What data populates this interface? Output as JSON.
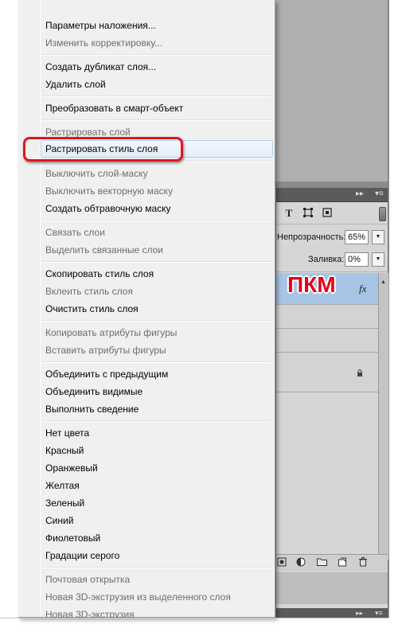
{
  "context_menu": {
    "items": [
      {
        "label": "Параметры наложения...",
        "enabled": true
      },
      {
        "label": "Изменить корректировку...",
        "enabled": false
      },
      {
        "label": "Создать дубликат слоя...",
        "enabled": true
      },
      {
        "label": "Удалить слой",
        "enabled": true
      },
      {
        "label": "Преобразовать в смарт-объект",
        "enabled": true
      },
      {
        "label": "Растрировать слой",
        "enabled": false
      },
      {
        "label": "Растрировать стиль слоя",
        "enabled": true,
        "highlighted": true
      },
      {
        "label": "Выключить слой-маску",
        "enabled": false
      },
      {
        "label": "Выключить векторную маску",
        "enabled": false
      },
      {
        "label": "Создать обтравочную маску",
        "enabled": true
      },
      {
        "label": "Связать слои",
        "enabled": false
      },
      {
        "label": "Выделить связанные слои",
        "enabled": false
      },
      {
        "label": "Скопировать стиль слоя",
        "enabled": true
      },
      {
        "label": "Вклеить стиль слоя",
        "enabled": false
      },
      {
        "label": "Очистить стиль слоя",
        "enabled": true
      },
      {
        "label": "Копировать атрибуты фигуры",
        "enabled": false
      },
      {
        "label": "Вставить атрибуты фигуры",
        "enabled": false
      },
      {
        "label": "Объединить с предыдущим",
        "enabled": true
      },
      {
        "label": "Объединить видимые",
        "enabled": true
      },
      {
        "label": "Выполнить сведение",
        "enabled": true
      },
      {
        "label": "Нет цвета",
        "enabled": true
      },
      {
        "label": "Красный",
        "enabled": true
      },
      {
        "label": "Оранжевый",
        "enabled": true
      },
      {
        "label": "Желтая",
        "enabled": true
      },
      {
        "label": "Зеленый",
        "enabled": true
      },
      {
        "label": "Синий",
        "enabled": true
      },
      {
        "label": "Фиолетовый",
        "enabled": true
      },
      {
        "label": "Градации серого",
        "enabled": true
      },
      {
        "label": "Почтовая открытка",
        "enabled": false
      },
      {
        "label": "Новая 3D-экструзия из выделенного слоя",
        "enabled": false
      },
      {
        "label": "Новая 3D-экструзия",
        "enabled": false
      }
    ]
  },
  "layers_panel": {
    "opacity_label": "Непрозрачность:",
    "opacity_value": "65%",
    "fill_label": "Заливка:",
    "fill_value": "0%",
    "fx_label": "fx",
    "type_filter_glyph": "T",
    "icons": [
      "type-filter-icon",
      "shape-filter-icon",
      "smart-filter-icon",
      "fx-icon",
      "lock-icon",
      "link-layers-icon",
      "adjustment-icon",
      "group-folder-icon",
      "new-layer-icon",
      "trash-icon"
    ]
  },
  "annotation": {
    "label": "ПКМ",
    "color": "#e40018"
  },
  "colors": {
    "menu_bg": "#f0f0f0",
    "highlight_border": "#aecff7",
    "selected_layer": "#a9c5e6",
    "panel_header": "#5b5b5b"
  }
}
